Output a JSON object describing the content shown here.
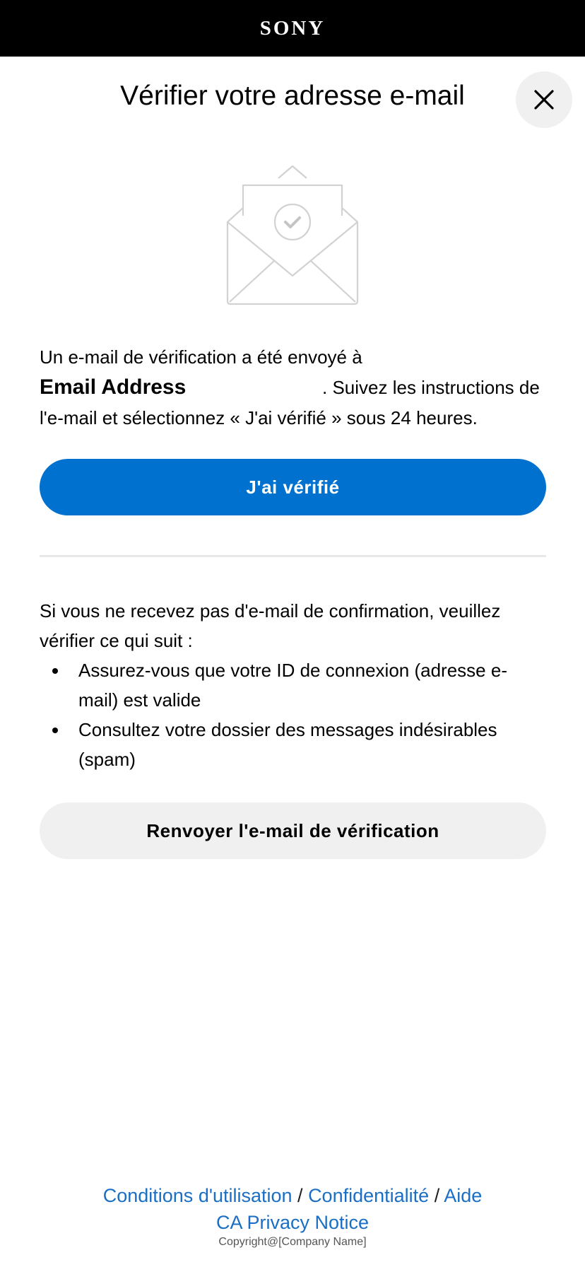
{
  "header": {
    "brand": "SONY",
    "background": "#000000"
  },
  "page": {
    "title": "Vérifier votre adresse e-mail",
    "close_icon": "close-icon",
    "illustration_icon": "envelope-check-icon"
  },
  "message": {
    "line1": "Un e-mail de vérification a été envoyé à",
    "email_address": "Email Address",
    "line2": ". Suivez les instructions de l'e-mail et sélectionnez « J'ai vérifié » sous 24 heures."
  },
  "primary_button": {
    "label": "J'ai vérifié",
    "color": "#0071ce"
  },
  "help": {
    "intro": "Si vous ne recevez pas d'e-mail de confirmation, veuillez vérifier ce qui suit :",
    "items": [
      "Assurez-vous que votre ID de connexion (adresse e-mail) est valide",
      "Consultez votre dossier des messages indésirables (spam)"
    ]
  },
  "secondary_button": {
    "label": "Renvoyer l'e-mail de vérification"
  },
  "footer": {
    "terms": "Conditions d'utilisation",
    "separator1": " / ",
    "privacy": "Confidentialité",
    "separator2": " / ",
    "help": "Aide",
    "ca_privacy": "CA Privacy Notice",
    "copyright": "Copyright@[Company Name]",
    "link_color": "#1a6fc4"
  }
}
